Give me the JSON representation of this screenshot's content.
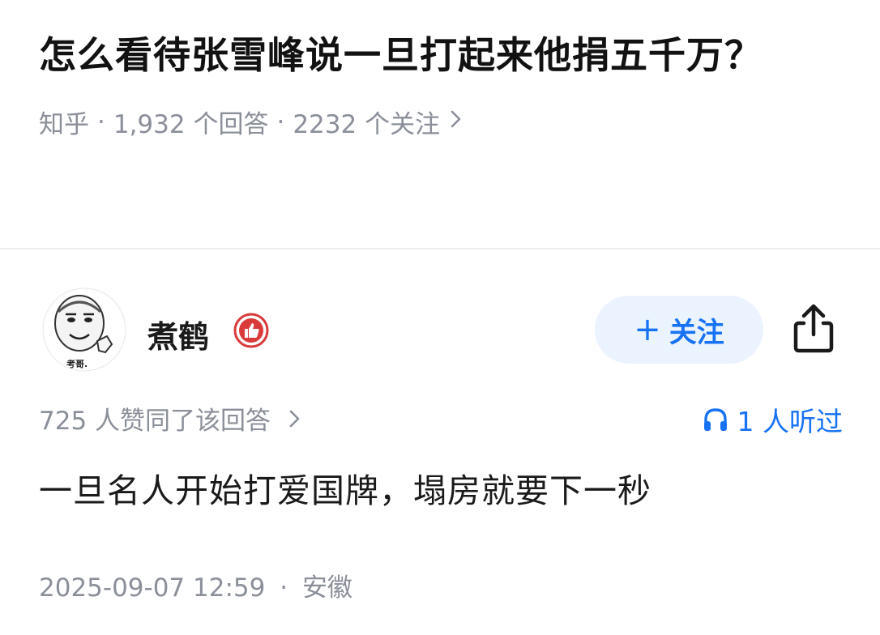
{
  "question": {
    "title": "怎么看待张雪峰说一旦打起来他捐五千万？",
    "source": "知乎",
    "answers_count": "1,932 个回答",
    "followers_count": "2232 个关注",
    "separator": "·"
  },
  "answer": {
    "author": {
      "name": "煮鹤",
      "avatar_caption": "考哥."
    },
    "follow_label": "关注",
    "upvote_text": "725 人赞同了该回答",
    "listen_text": "1 人听过",
    "content": "一旦名人开始打爱国牌，塌房就要下一秒",
    "timestamp": "2025-09-07 12:59",
    "location": "安徽",
    "separator": "·"
  },
  "colors": {
    "accent": "#1772f6",
    "follow_bg": "#ebf3ff",
    "meta_gray": "#8a8f99",
    "badge_red": "#d93a3a"
  },
  "icons": {
    "share": "share-icon",
    "headphones": "headphones-icon",
    "chevron": "chevron-right-icon",
    "badge": "thumbs-up-badge-icon"
  }
}
